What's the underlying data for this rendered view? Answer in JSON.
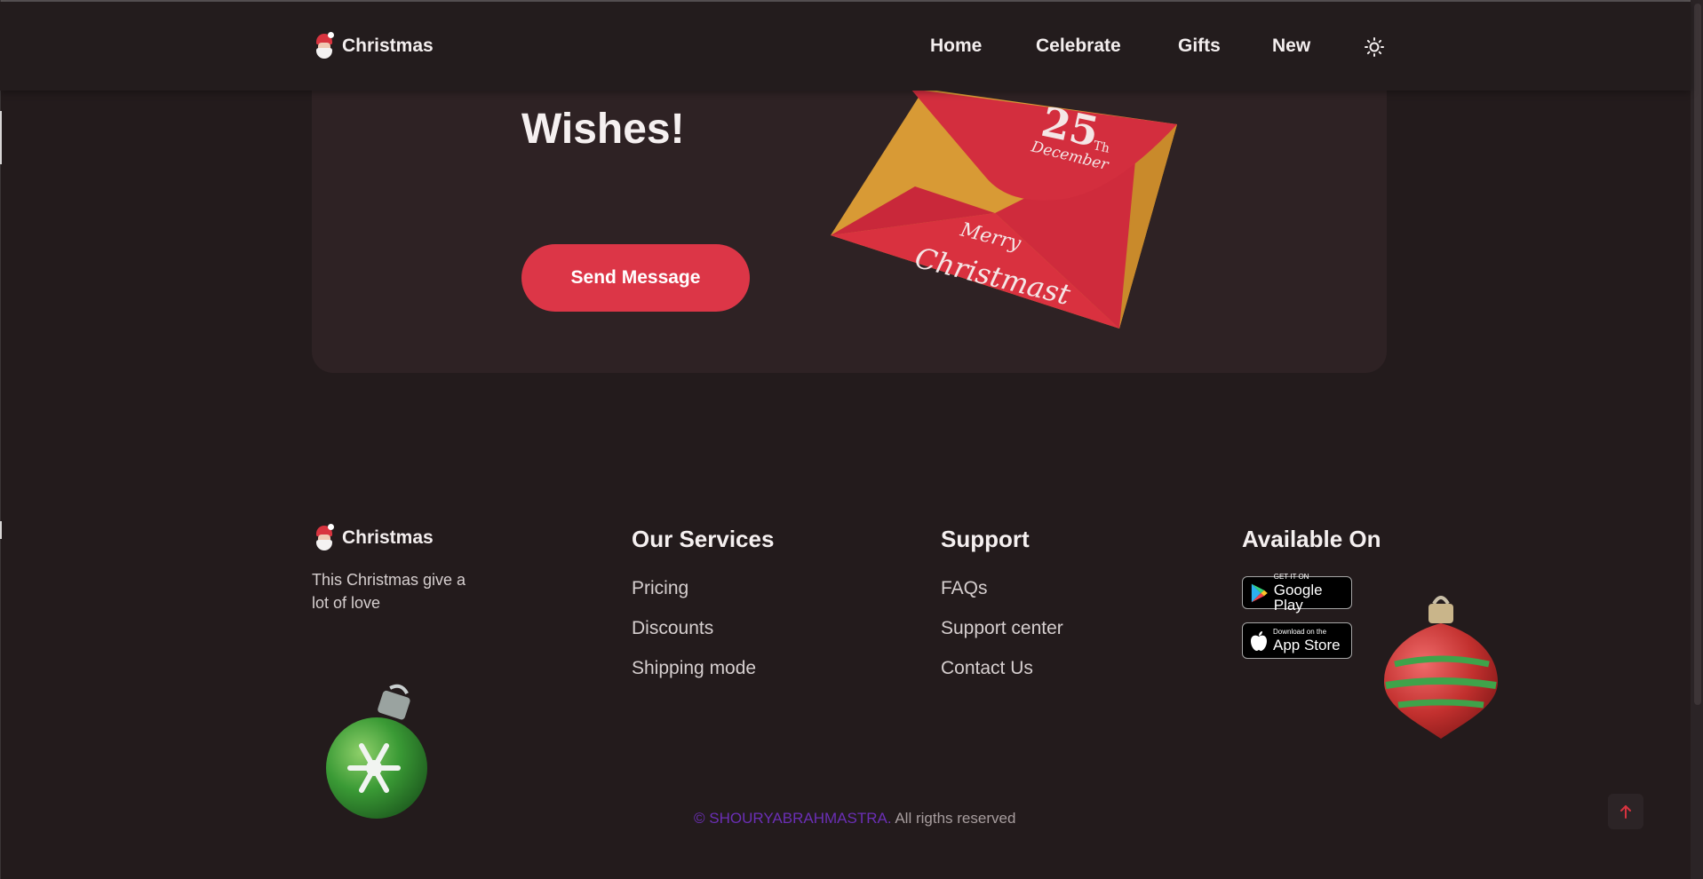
{
  "header": {
    "logo_text": "Christmas",
    "nav": [
      {
        "label": "Home"
      },
      {
        "label": "Celebrate"
      },
      {
        "label": "Gifts"
      },
      {
        "label": "New"
      }
    ],
    "theme_icon": "sun-icon"
  },
  "hero": {
    "title": "Wishes!",
    "button_label": "Send Message",
    "envelope": {
      "date_number": "25",
      "date_suffix": "Th",
      "month": "December",
      "greeting_line1": "Merry",
      "greeting_line2": "Christmast"
    }
  },
  "footer": {
    "logo_text": "Christmas",
    "tagline": "This Christmas give a lot of love",
    "services": {
      "heading": "Our Services",
      "links": [
        "Pricing",
        "Discounts",
        "Shipping mode"
      ]
    },
    "support": {
      "heading": "Support",
      "links": [
        "FAQs",
        "Support center",
        "Contact Us"
      ]
    },
    "available": {
      "heading": "Available On",
      "google_play_small": "GET IT ON",
      "google_play_big": "Google Play",
      "app_store_small": "Download on the",
      "app_store_big": "App Store"
    },
    "copyright_brand": "© SHOURYABRAHMASTRA.",
    "copyright_rest": "All rigths reserved"
  },
  "colors": {
    "background": "#231b1c",
    "card": "#2e2224",
    "accent_red": "#dc3647",
    "envelope_gold": "#d89a35",
    "brand_purple": "#6b2fb6"
  },
  "icons": {
    "scroll_top": "arrow-up-icon",
    "logo": "santa-icon",
    "google_play": "google-play-icon",
    "app_store": "apple-icon"
  }
}
